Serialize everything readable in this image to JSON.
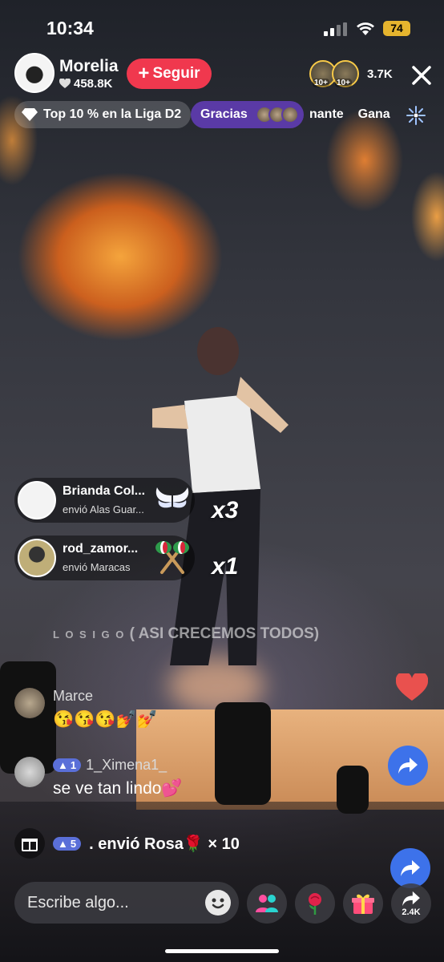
{
  "status_bar": {
    "time": "10:34",
    "battery": "74"
  },
  "host": {
    "name": "Morelia",
    "likes": "458.8K",
    "follow_label": "Seguir"
  },
  "viewers": {
    "badge_1": "10+",
    "badge_2": "10+",
    "count": "3.7K"
  },
  "chips": {
    "rank": "Top 10 % en la Liga D2",
    "thanks": "Gracias",
    "ticker_1": "nante",
    "ticker_2": "Gana"
  },
  "gifts": [
    {
      "user": "Brianda Col...",
      "desc": "envió Alas Guar...",
      "multiplier": "x3"
    },
    {
      "user": "rod_zamor...",
      "desc": "envió Maracas",
      "multiplier": "x1"
    }
  ],
  "system_message": {
    "prefix": "L O S I G O",
    "text": "( ASI CRECEMOS TODOS)"
  },
  "comments": [
    {
      "user": "Marce",
      "text": "😘😘😘💅💅"
    },
    {
      "user": "1_Ximena1_",
      "level": "1",
      "text": "se ve tan lindo💕"
    }
  ],
  "gift_announcement": {
    "level": "5",
    "text": ". envió Rosa🌹 × 10"
  },
  "bottom": {
    "placeholder": "Escribe algo...",
    "share_count": "2.4K"
  },
  "colors": {
    "follow": "#f0384e",
    "thanks_chip": "#5a3aa6",
    "fab": "#3d72ea",
    "level_badge": "#5a6fd8"
  }
}
